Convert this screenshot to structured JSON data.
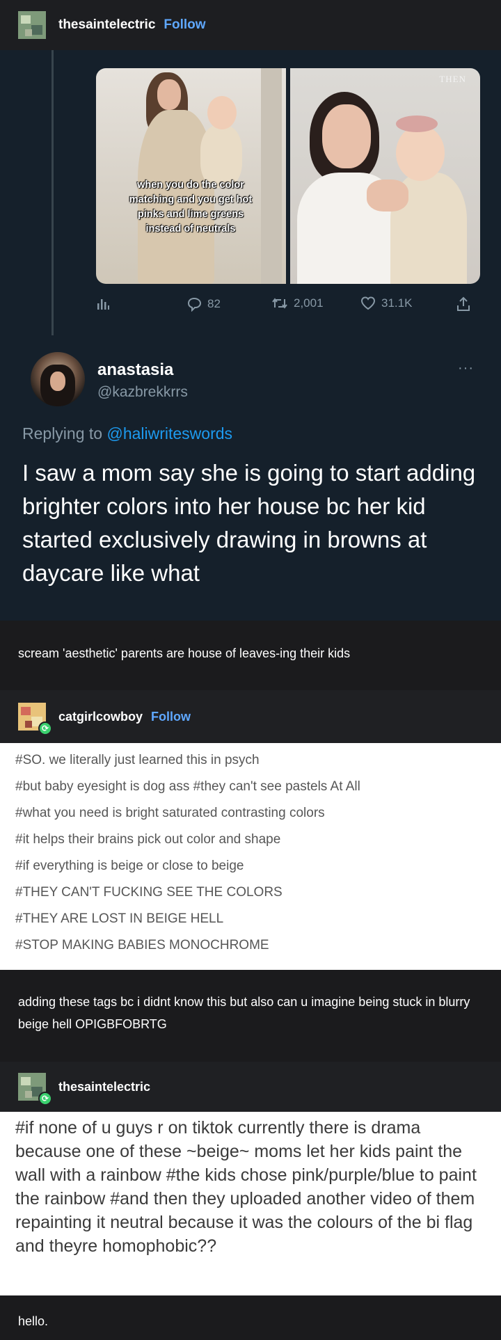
{
  "header1": {
    "username": "thesaintelectric",
    "follow": "Follow"
  },
  "tweet": {
    "media": {
      "caption_lines": [
        "when you do the color",
        "matching and you get hot",
        "pinks and lime greens",
        "instead of neutrals"
      ],
      "then_label": "THEN"
    },
    "actions": {
      "replies": "82",
      "retweets": "2,001",
      "likes": "31.1K"
    },
    "reply": {
      "name": "anastasia",
      "handle": "@kazbrekkrrs",
      "more": "···",
      "replying_prefix": "Replying to ",
      "replying_mention": "@haliwriteswords",
      "text": "I saw a mom say she is going to start adding brighter colors into her house bc her kid started exclusively drawing in browns at daycare like what"
    }
  },
  "comment1": {
    "text": "scream 'aesthetic' parents are house of leaves-ing their kids"
  },
  "header2": {
    "username": "catgirlcowboy",
    "follow": "Follow"
  },
  "tags": [
    "#SO. we literally just learned this in psych",
    "#but baby eyesight is dog ass   #they can't see pastels At All",
    "#what you need is bright saturated contrasting colors",
    "#it helps their brains pick out color and shape",
    "#if everything is beige or close to beige",
    "#THEY CAN'T FUCKING SEE THE COLORS",
    "#THEY ARE LOST IN BEIGE HELL",
    "#STOP MAKING BABIES MONOCHROME"
  ],
  "comment2": {
    "text": "adding these tags bc i didnt know this but also can u imagine being stuck in blurry beige hell OPIGBFOBRTG"
  },
  "header3": {
    "username": "thesaintelectric"
  },
  "bigpost": {
    "text": "#if none of u guys r on tiktok currently there is drama because one of these ~beige~ moms let her kids paint the wall with a rainbow  #the kids chose pink/purple/blue to paint the rainbow  #and then they uploaded another video of them repainting it neutral because it was the colours of the bi flag and theyre homophobic??"
  },
  "comment3": {
    "text": "hello."
  }
}
